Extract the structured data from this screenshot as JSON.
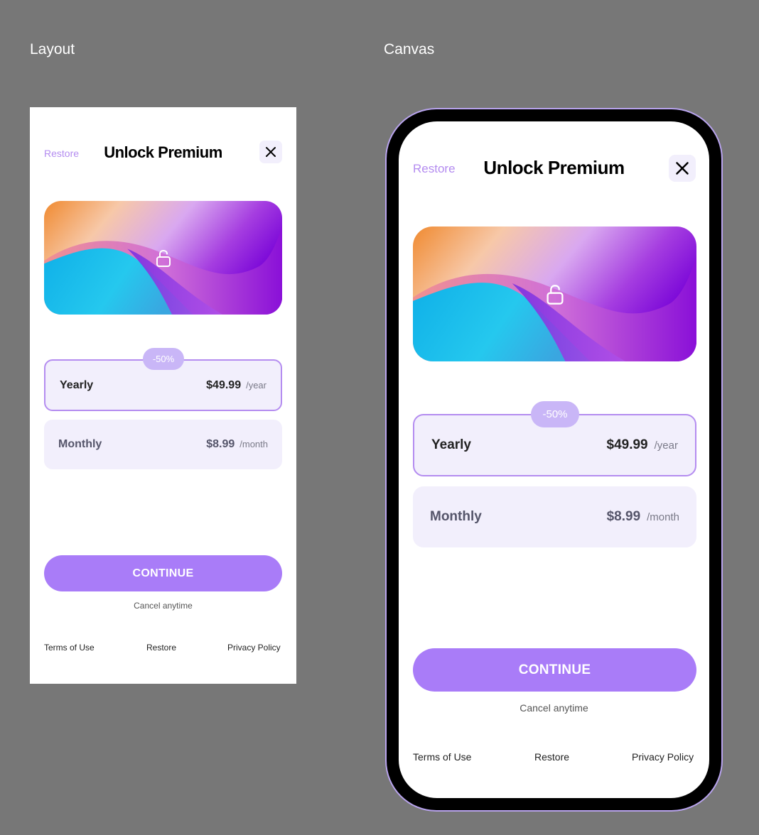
{
  "sections": {
    "layout_label": "Layout",
    "canvas_label": "Canvas"
  },
  "paywall": {
    "header": {
      "restore_label": "Restore",
      "title": "Unlock Premium",
      "close_icon": "close-icon"
    },
    "hero": {
      "icon": "unlock-icon"
    },
    "discount_badge": "-50%",
    "plans": [
      {
        "name": "Yearly",
        "price": "$49.99",
        "period": "/year",
        "selected": true
      },
      {
        "name": "Monthly",
        "price": "$8.99",
        "period": "/month",
        "selected": false
      }
    ],
    "continue_label": "CONTINUE",
    "cancel_note": "Cancel anytime",
    "footer": {
      "terms": "Terms of Use",
      "restore": "Restore",
      "privacy": "Privacy Policy"
    }
  },
  "colors": {
    "background": "#777777",
    "accent": "#a97cf8",
    "accent_light": "#b48cf0",
    "plan_bg": "#f2effc",
    "badge_bg": "#c9b6f7",
    "device_border": "#b9a4ef"
  }
}
